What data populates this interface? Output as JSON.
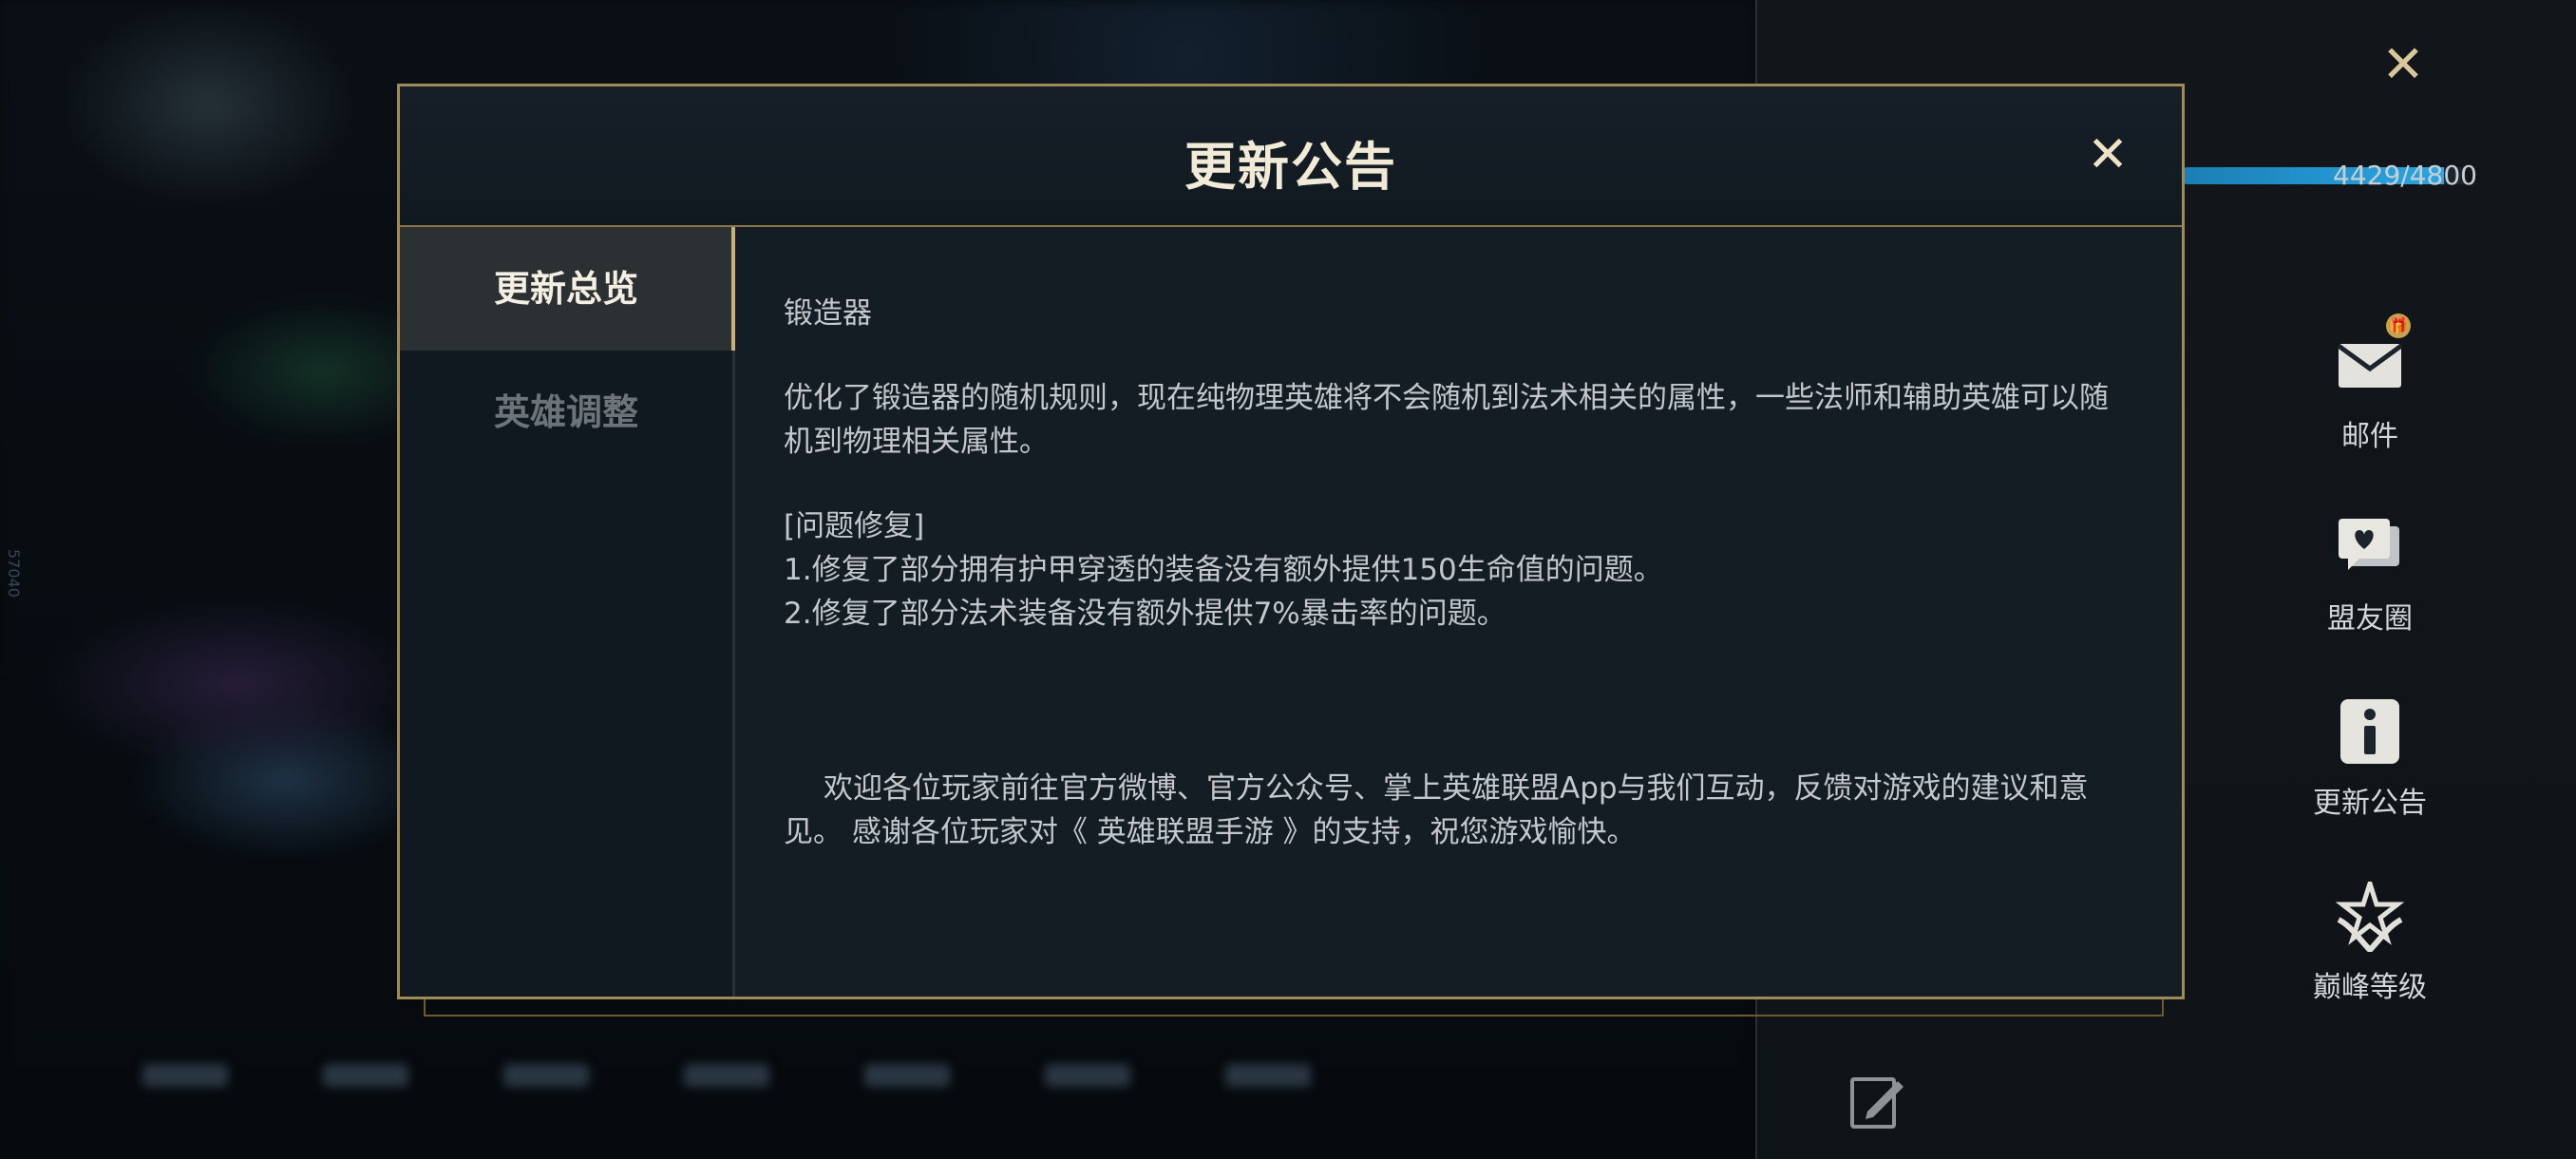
{
  "app": {
    "side_text": "57040"
  },
  "modal": {
    "title": "更新公告",
    "tabs": [
      {
        "label": "更新总览",
        "active": true
      },
      {
        "label": "英雄调整",
        "active": false
      }
    ],
    "content": {
      "heading": "锻造器",
      "para1": "优化了锻造器的随机规则，现在纯物理英雄将不会随机到法术相关的属性，一些法师和辅助英雄可以随机到物理相关属性。",
      "fix_title": "[问题修复]",
      "fix1": "1.修复了部分拥有护甲穿透的装备没有额外提供150生命值的问题。",
      "fix2": "2.修复了部分法术装备没有额外提供7%暴击率的问题。",
      "closing": "欢迎各位玩家前往官方微博、官方公众号、掌上英雄联盟App与我们互动，反馈对游戏的建议和意见。 感谢各位玩家对《 英雄联盟手游 》的支持，祝您游戏愉快。"
    }
  },
  "right_panel": {
    "progress": {
      "text": "4429/4800",
      "fraction": 0.922
    },
    "buttons": [
      {
        "label": "邮件",
        "icon": "mail-icon"
      },
      {
        "label": "盟友圈",
        "icon": "friends-circle-icon"
      },
      {
        "label": "更新公告",
        "icon": "info-icon"
      },
      {
        "label": "巅峰等级",
        "icon": "peak-rank-icon"
      }
    ]
  },
  "colors": {
    "accent_gold": "#a08a56",
    "progress_blue": "#2aa6e2"
  }
}
